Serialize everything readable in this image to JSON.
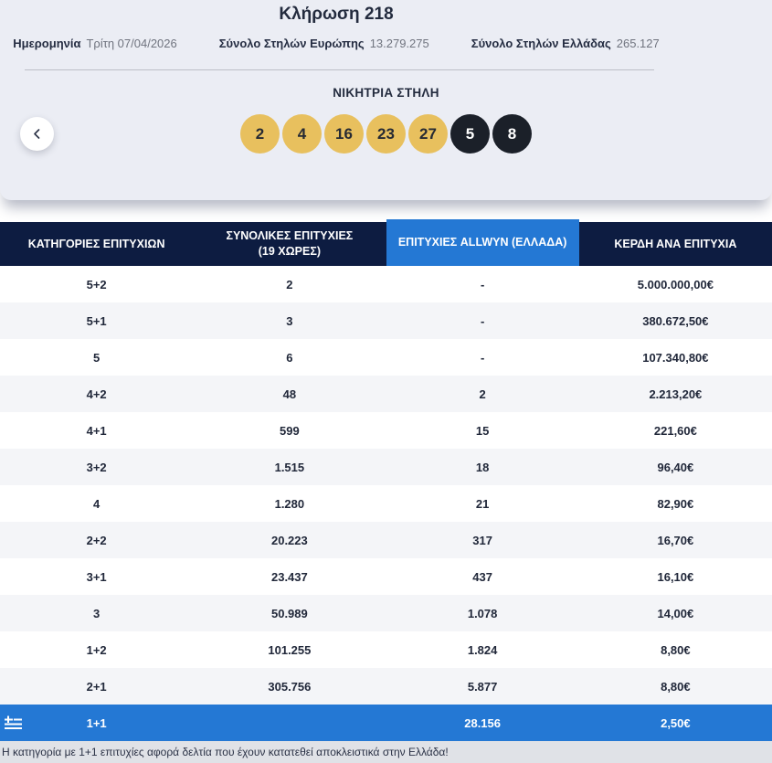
{
  "header": {
    "title": "Κλήρωση 218",
    "meta": [
      {
        "label": "Ημερομηνία",
        "value": "Τρίτη 07/04/2026"
      },
      {
        "label": "Σύνολο Στηλών Ευρώπης",
        "value": "13.279.275"
      },
      {
        "label": "Σύνολο Στηλών Ελλάδας",
        "value": "265.127"
      }
    ]
  },
  "winning": {
    "title": "ΝΙΚΗΤΡΙΑ ΣΤΗΛΗ",
    "numbers": [
      "2",
      "4",
      "16",
      "23",
      "27"
    ],
    "bonus_numbers": [
      "5",
      "8"
    ]
  },
  "icons": {
    "back": "chevron-left-icon",
    "flag": "greek-flag-icon"
  },
  "colors": {
    "accent_blue": "#2478d4",
    "header_navy": "#0d1c41",
    "ball_gold": "#e8c05e",
    "ball_dark": "#1b2029",
    "card_bg": "#ebedf4"
  },
  "table": {
    "columns": {
      "categories": "ΚΑΤΗΓΟΡΙΕΣ ΕΠΙΤΥΧΙΩΝ",
      "total_line1": "ΣΥΝΟΛΙΚΕΣ ΕΠΙΤΥΧΙΕΣ",
      "total_line2": "(19 ΧΩΡΕΣ)",
      "allwyn": "ΕΠΙΤΥΧΙΕΣ ALLWYN (ΕΛΛΑΔΑ)",
      "prize": "ΚΕΡΔΗ ΑΝΑ ΕΠΙΤΥΧΙΑ"
    },
    "rows": [
      {
        "category": "5+2",
        "total": "2",
        "greece": "-",
        "prize": "5.000.000,00€"
      },
      {
        "category": "5+1",
        "total": "3",
        "greece": "-",
        "prize": "380.672,50€"
      },
      {
        "category": "5",
        "total": "6",
        "greece": "-",
        "prize": "107.340,80€"
      },
      {
        "category": "4+2",
        "total": "48",
        "greece": "2",
        "prize": "2.213,20€"
      },
      {
        "category": "4+1",
        "total": "599",
        "greece": "15",
        "prize": "221,60€"
      },
      {
        "category": "3+2",
        "total": "1.515",
        "greece": "18",
        "prize": "96,40€"
      },
      {
        "category": "4",
        "total": "1.280",
        "greece": "21",
        "prize": "82,90€"
      },
      {
        "category": "2+2",
        "total": "20.223",
        "greece": "317",
        "prize": "16,70€"
      },
      {
        "category": "3+1",
        "total": "23.437",
        "greece": "437",
        "prize": "16,10€"
      },
      {
        "category": "3",
        "total": "50.989",
        "greece": "1.078",
        "prize": "14,00€"
      },
      {
        "category": "1+2",
        "total": "101.255",
        "greece": "1.824",
        "prize": "8,80€"
      },
      {
        "category": "2+1",
        "total": "305.756",
        "greece": "5.877",
        "prize": "8,80€"
      }
    ],
    "highlight_row": {
      "category": "1+1",
      "total": "",
      "greece": "28.156",
      "prize": "2,50€"
    },
    "footnote": "Η κατηγορία με 1+1 επιτυχίες αφορά δελτία που έχουν κατατεθεί αποκλειστικά στην Ελλάδα!"
  }
}
